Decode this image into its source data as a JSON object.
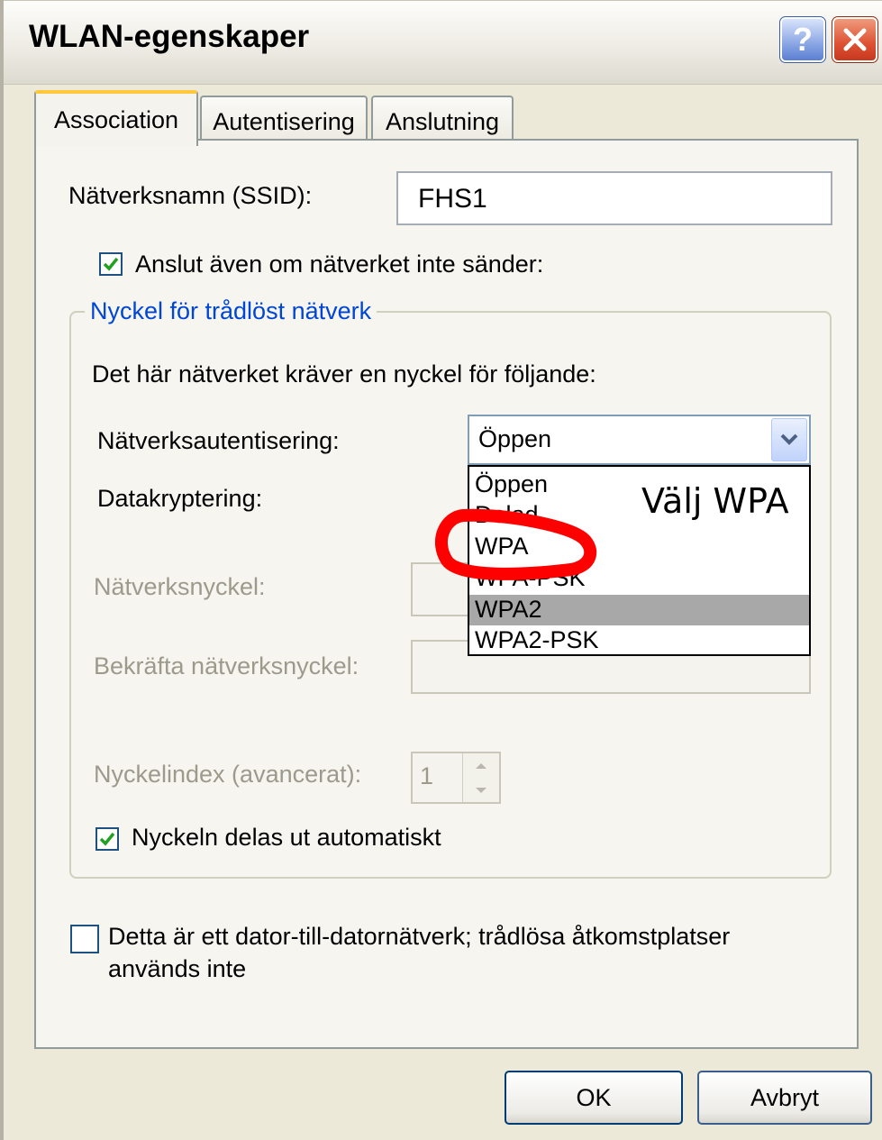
{
  "window": {
    "title": "WLAN-egenskaper",
    "help_glyph": "?"
  },
  "tabs": [
    {
      "label": "Association",
      "active": true
    },
    {
      "label": "Autentisering",
      "active": false
    },
    {
      "label": "Anslutning",
      "active": false
    }
  ],
  "ssid": {
    "label": "Nätverksnamn (SSID):",
    "value": "FHS1"
  },
  "connect_hidden": {
    "label": "Anslut även om nätverket inte sänder:",
    "checked": true
  },
  "key_group": {
    "legend": "Nyckel för trådlöst nätverk",
    "intro": "Det här nätverket kräver en nyckel för följande:",
    "auth_label": "Nätverksautentisering:",
    "auth_value": "Öppen",
    "auth_options": [
      "Öppen",
      "Delad",
      "WPA",
      "WPA-PSK",
      "WPA2",
      "WPA2-PSK"
    ],
    "auth_highlighted": "WPA2",
    "encryption_label": "Datakryptering:",
    "network_key_label": "Nätverksnyckel:",
    "confirm_key_label": "Bekräfta nätverksnyckel:",
    "key_index_label": "Nyckelindex (avancerat):",
    "key_index_value": "1",
    "auto_key_label": "Nyckeln delas ut automatiskt",
    "auto_key_checked": true
  },
  "adhoc": {
    "label_line1": "Detta är ett dator-till-datornätverk; trådlösa åtkomstplatser",
    "label_line2": "används inte",
    "checked": false
  },
  "buttons": {
    "ok": "OK",
    "cancel": "Avbryt"
  },
  "annotation": {
    "text": "Välj WPA",
    "color": "#ff0000"
  }
}
